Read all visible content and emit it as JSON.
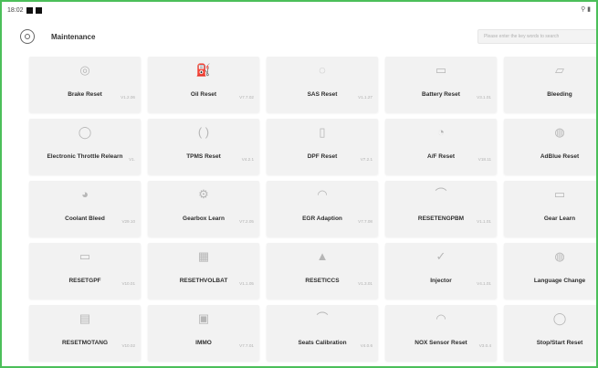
{
  "statusbar": {
    "time": "18:02"
  },
  "header": {
    "title": "Maintenance",
    "search_placeholder": "Please enter the key words to search"
  },
  "tiles": [
    {
      "label": "Brake Reset",
      "version": "V1.2.06",
      "icon": "brake-icon"
    },
    {
      "label": "Oil Reset",
      "version": "V7.7.02",
      "icon": "oil-can-icon"
    },
    {
      "label": "SAS Reset",
      "version": "V1.1.27",
      "icon": "steering-wheel-icon"
    },
    {
      "label": "Battery Reset",
      "version": "V3.1.01",
      "icon": "battery-icon"
    },
    {
      "label": "Bleeding",
      "version": "V1.",
      "icon": "bleeding-icon"
    },
    {
      "label": "Electronic Throttle Relearn",
      "version": "V1.",
      "icon": "throttle-icon"
    },
    {
      "label": "TPMS Reset",
      "version": "V4.2.1",
      "icon": "tire-pressure-icon"
    },
    {
      "label": "DPF Reset",
      "version": "V7.2.1",
      "icon": "dpf-icon"
    },
    {
      "label": "A/F Reset",
      "version": "V18.11",
      "icon": "af-sensor-icon"
    },
    {
      "label": "AdBlue Reset",
      "version": "V1.",
      "icon": "adblue-icon"
    },
    {
      "label": "Coolant Bleed",
      "version": "V29.10",
      "icon": "coolant-icon"
    },
    {
      "label": "Gearbox Learn",
      "version": "V7.2.05",
      "icon": "gearbox-icon"
    },
    {
      "label": "EGR Adaption",
      "version": "V7.7.08",
      "icon": "egr-icon"
    },
    {
      "label": "RESETENGPBM",
      "version": "V1.1.01",
      "icon": "engine-icon"
    },
    {
      "label": "Gear Learn",
      "version": "V1.",
      "icon": "gear-learn-icon"
    },
    {
      "label": "RESETGPF",
      "version": "V10.01",
      "icon": "gpf-icon"
    },
    {
      "label": "RESETHVOLBAT",
      "version": "V1.1.05",
      "icon": "hv-battery-icon"
    },
    {
      "label": "RESETICCS",
      "version": "V1.3.01",
      "icon": "iccs-icon"
    },
    {
      "label": "Injector",
      "version": "V4.1.01",
      "icon": "injector-icon"
    },
    {
      "label": "Language Change",
      "version": "V1.",
      "icon": "language-icon"
    },
    {
      "label": "RESETMOTANG",
      "version": "V10.02",
      "icon": "motor-icon"
    },
    {
      "label": "IMMO",
      "version": "V7.7.01",
      "icon": "immo-icon"
    },
    {
      "label": "Seats Calibration",
      "version": "V4.0.6",
      "icon": "seat-icon"
    },
    {
      "label": "NOX Sensor Reset",
      "version": "V3.0.4",
      "icon": "nox-sensor-icon"
    },
    {
      "label": "Stop/Start Reset",
      "version": "",
      "icon": "stop-start-icon"
    }
  ]
}
